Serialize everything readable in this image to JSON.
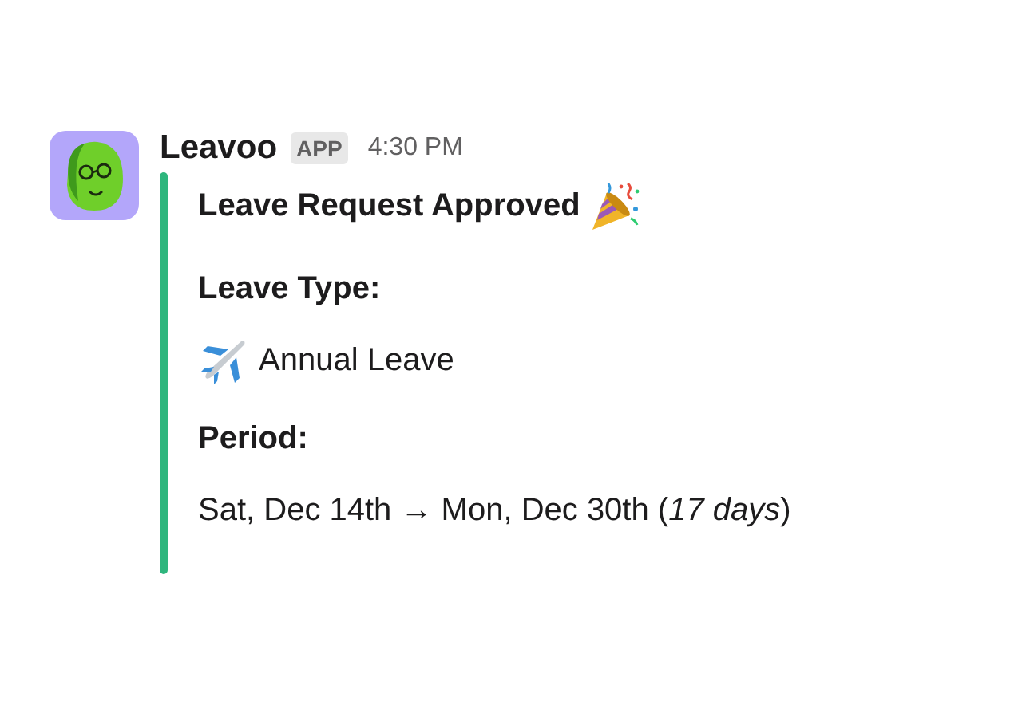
{
  "message": {
    "sender": "Leavoo",
    "badge": "APP",
    "time": "4:30 PM",
    "attachment": {
      "color": "#2eb67d",
      "title": "Leave Request Approved",
      "fields": [
        {
          "label": "Leave Type:",
          "value": "Annual Leave",
          "kind": "airplane"
        },
        {
          "label": "Period:",
          "value": "Sat, Dec 14th → Mon, Dec 30th (*17 days*)",
          "kind": "plain"
        }
      ]
    }
  }
}
